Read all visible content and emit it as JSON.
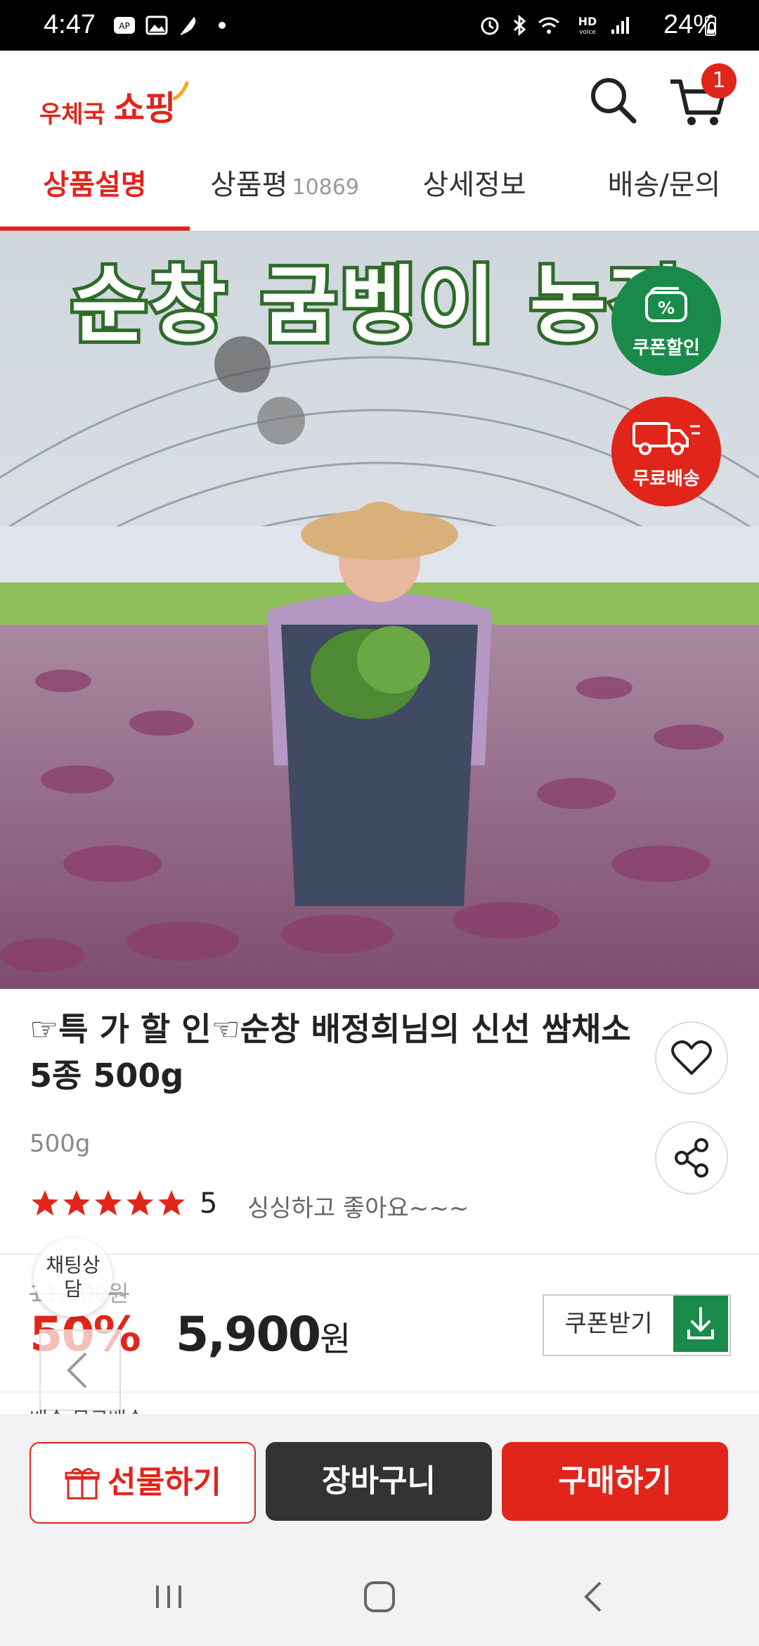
{
  "status_bar": {
    "time": "4:47",
    "battery": "24%",
    "icons": [
      "ap-icon",
      "gallery-icon",
      "feather-icon",
      "dot-icon",
      "alarm-icon",
      "bluetooth-icon",
      "wifi-icon",
      "hd-voice-icon",
      "signal-icon",
      "battery-icon"
    ]
  },
  "header": {
    "logo_small": "우체국",
    "logo_big": "쇼핑",
    "cart_count": "1",
    "icons": [
      "search-icon",
      "cart-icon"
    ]
  },
  "tabs": [
    {
      "label": "상품설명",
      "active": true
    },
    {
      "label": "상품평",
      "count": "10869",
      "active": false
    },
    {
      "label": "상세정보",
      "active": false
    },
    {
      "label": "배송/문의",
      "active": false
    }
  ],
  "hero": {
    "banner_text": "순창 굼벵이 농장",
    "badges": [
      {
        "label": "쿠폰할인",
        "icon": "coupon-percent-icon",
        "color": "#1a8a4a"
      },
      {
        "label": "무료배송",
        "icon": "truck-icon",
        "color": "#e1251b"
      }
    ]
  },
  "product": {
    "title": "☞특 가 할 인☜순창 배정희님의 신선 쌈채소 5종 500g",
    "weight": "500g",
    "rating": "5",
    "stars": 5,
    "review_snippet": "싱싱하고 좋아요~~~",
    "original_price": "11,800원",
    "discount": "50%",
    "price": "5,900",
    "price_unit": "원",
    "coupon_button": "쿠폰받기",
    "chat_button": "채팅상담",
    "peek_text": "배송 무료배송"
  },
  "action_bar": {
    "gift": "선물하기",
    "cart": "장바구니",
    "buy": "구매하기"
  },
  "colors": {
    "brand_red": "#e1251b",
    "coupon_green": "#1a8a4a",
    "dark": "#333333"
  }
}
